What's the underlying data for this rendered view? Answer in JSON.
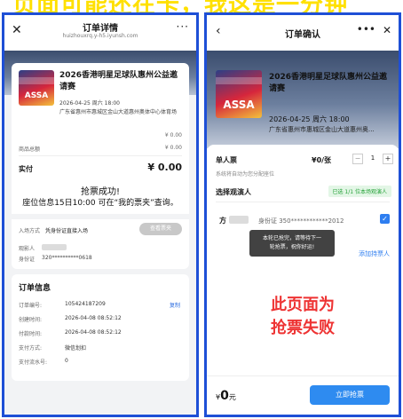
{
  "banner": {
    "text": "页面可能还在卡，我这是一分钟"
  },
  "left": {
    "header": {
      "close_glyph": "✕",
      "title": "订单详情",
      "subtitle": "huizhouxrq.y-h5.iyunsh.com",
      "more_glyph": "···"
    },
    "event": {
      "title": "2026香港明星足球队惠州公益邀请赛",
      "date": "2026-04-25 周六 18:00",
      "venue": "广东省惠州市惠城区金山大道惠州奥体中心体育场",
      "poster_text": "ASSA"
    },
    "amounts": {
      "line1": "¥ 0.00",
      "total_label": "商品总额",
      "total_value": "¥ 0.00",
      "paid_label": "实付",
      "paid_value": "¥ 0.00"
    },
    "success_text": "抢票成功!",
    "seat_info": "座位信息15日10:00 可在“我的票夹”查询。",
    "entry": {
      "label": "入场方式",
      "value": "凭身份证直接入场",
      "button": "查看票夹"
    },
    "viewer": {
      "label": "观影人",
      "id_label": "身份证",
      "id_value": "320**********0618"
    },
    "order": {
      "title": "订单信息",
      "copy": "复制",
      "rows": [
        {
          "label": "订单编号:",
          "value": "105424187209"
        },
        {
          "label": "创建时间:",
          "value": "2026-04-08 08:52:12"
        },
        {
          "label": "付款时间:",
          "value": "2026-04-08 08:52:12"
        },
        {
          "label": "支付方式:",
          "value": "微信划扣"
        },
        {
          "label": "支付流水号:",
          "value": "0"
        }
      ]
    }
  },
  "right": {
    "header": {
      "back_glyph": "‹",
      "title": "订单确认",
      "more_glyph": "•••",
      "close_glyph": "✕"
    },
    "event": {
      "title": "2026香港明星足球队惠州公益邀请赛",
      "date": "2026-04-25 周六 18:00",
      "venue": "广东省惠州市惠城区金山大道惠州奥...",
      "poster_text": "ASSA"
    },
    "ticket": {
      "label": "单人票",
      "price": "¥0/张",
      "minus": "−",
      "qty": "1",
      "plus": "+",
      "auto_seat": "系统将自动为您分配座位"
    },
    "viewer_section": {
      "label": "选择观演人",
      "badge": "已选 1/1 位本场观演人"
    },
    "viewer": {
      "name_initial": "方",
      "id_text": "身份证 350************2012",
      "check": "✓"
    },
    "toast": {
      "line1": "本轮已抢完，请等待下一",
      "line2": "轮抢票，祝你好运!"
    },
    "add_viewer": "添加持票人",
    "fail_text_line1": "此页面为",
    "fail_text_line2": "抢票失败",
    "footer": {
      "yen": "¥",
      "amount": "0",
      "unit": "元",
      "buy_button": "立即抢票"
    }
  },
  "colors": {
    "frame": "#1e4fd6",
    "accent_blue": "#2e8bf0",
    "fail_red": "#ee3333",
    "badge_green": "#27a23a"
  },
  "icons": [
    "close-icon",
    "more-icon",
    "back-icon",
    "check-icon"
  ]
}
